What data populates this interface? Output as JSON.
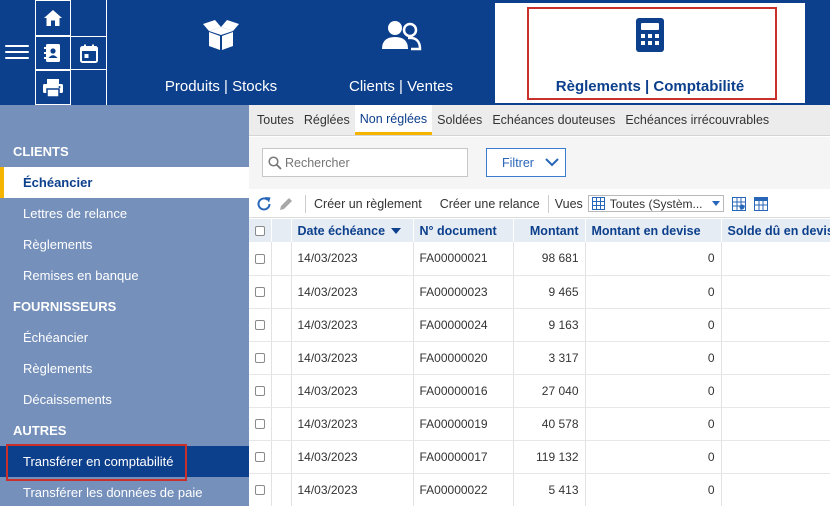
{
  "header": {
    "nav": [
      {
        "label": "Produits | Stocks",
        "icon": "box-open-icon"
      },
      {
        "label": "Clients | Ventes",
        "icon": "users-icon"
      },
      {
        "label": "Règlements | Comptabilité",
        "icon": "calculator-icon",
        "active": true
      }
    ],
    "quick_icons": [
      "home-icon",
      "address-book-icon",
      "calendar-icon",
      "printer-icon",
      "menu-icon"
    ]
  },
  "sidebar": {
    "sections": [
      {
        "title": "CLIENTS",
        "items": [
          "Échéancier",
          "Lettres de relance",
          "Règlements",
          "Remises en banque"
        ]
      },
      {
        "title": "FOURNISSEURS",
        "items": [
          "Échéancier",
          "Règlements",
          "Décaissements"
        ]
      },
      {
        "title": "AUTRES",
        "items": [
          "Transférer en comptabilité",
          "Transférer les données de paie"
        ]
      }
    ],
    "active_item": "Échéancier",
    "selected_item": "Transférer en comptabilité"
  },
  "tabs": [
    "Toutes",
    "Réglées",
    "Non réglées",
    "Soldées",
    "Echéances douteuses",
    "Echéances irrécouvrables"
  ],
  "active_tab": "Non réglées",
  "search": {
    "placeholder": "Rechercher"
  },
  "filter": {
    "label": "Filtrer"
  },
  "toolbar": {
    "create_payment": "Créer un règlement",
    "create_reminder": "Créer une relance",
    "views_label": "Vues",
    "views_value": "Toutes (Systèm..."
  },
  "table": {
    "columns": [
      "Date échéance",
      "N° document",
      "Montant",
      "Montant en devise",
      "Solde dû en devise"
    ],
    "rows": [
      {
        "date": "14/03/2023",
        "doc": "FA00000021",
        "montant": "98 681",
        "devise": "0"
      },
      {
        "date": "14/03/2023",
        "doc": "FA00000023",
        "montant": "9 465",
        "devise": "0"
      },
      {
        "date": "14/03/2023",
        "doc": "FA00000024",
        "montant": "9 163",
        "devise": "0"
      },
      {
        "date": "14/03/2023",
        "doc": "FA00000020",
        "montant": "3 317",
        "devise": "0"
      },
      {
        "date": "14/03/2023",
        "doc": "FA00000016",
        "montant": "27 040",
        "devise": "0"
      },
      {
        "date": "14/03/2023",
        "doc": "FA00000019",
        "montant": "40 578",
        "devise": "0"
      },
      {
        "date": "14/03/2023",
        "doc": "FA00000017",
        "montant": "119 132",
        "devise": "0"
      },
      {
        "date": "14/03/2023",
        "doc": "FA00000022",
        "montant": "5 413",
        "devise": "0"
      }
    ]
  },
  "colors": {
    "primary": "#0c3f8c",
    "sidebar": "#7590bb",
    "accent": "#f5b400",
    "highlight": "#c9302c"
  }
}
